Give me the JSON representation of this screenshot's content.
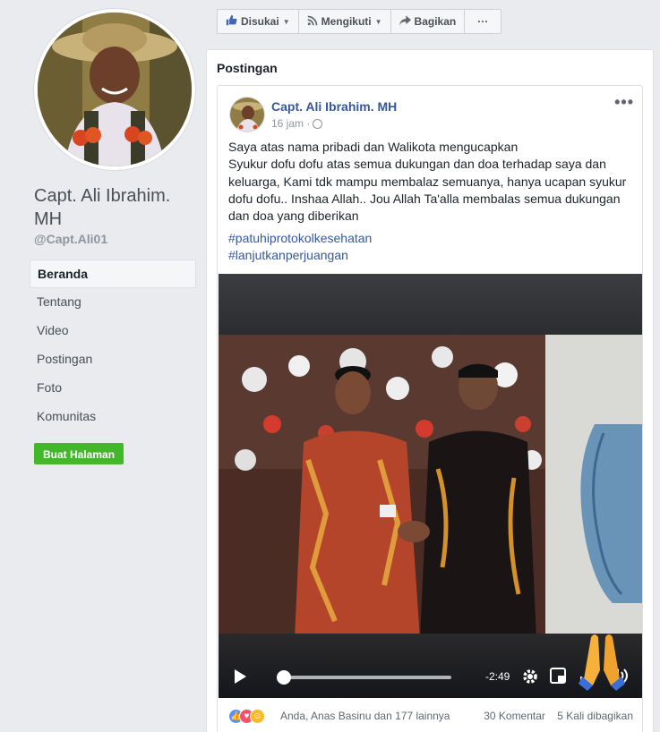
{
  "sidebar": {
    "page_name": "Capt. Ali Ibrahim. MH",
    "handle": "@Capt.Ali01",
    "nav": [
      {
        "label": "Beranda"
      },
      {
        "label": "Tentang"
      },
      {
        "label": "Video"
      },
      {
        "label": "Postingan"
      },
      {
        "label": "Foto"
      },
      {
        "label": "Komunitas"
      }
    ],
    "create_page_label": "Buat Halaman"
  },
  "actions": {
    "like_label": "Disukai",
    "follow_label": "Mengikuti",
    "share_label": "Bagikan",
    "more_label": "···"
  },
  "posts": {
    "section_title": "Postingan"
  },
  "post": {
    "author": "Capt. Ali Ibrahim. MH",
    "time": "16 jam ·",
    "more_label": "•••",
    "text_lines": [
      "Saya atas nama pribadi dan Walikota mengucapkan",
      "Syukur dofu dofu atas semua dukungan dan doa terhadap saya dan keluarga, Kami tdk mampu membalaz semuanya, hanya ucapan syukur dofu dofu.. Inshaa Allah.. Jou Allah Ta'alla membalas semua dukungan dan doa yang diberikan"
    ],
    "hashtags": [
      "#patuhiprotokolkesehatan",
      "#lanjutkanperjuangan"
    ],
    "video": {
      "time_remaining": "-2:49",
      "progress": 0.0
    },
    "reactions_text": "Anda, Anas Basinu dan 177 lainnya",
    "comments": "30 Komentar",
    "shares": "5 Kali dibagikan"
  },
  "colors": {
    "link": "#365899",
    "green_button": "#42b72a",
    "background": "#e9ebee"
  }
}
